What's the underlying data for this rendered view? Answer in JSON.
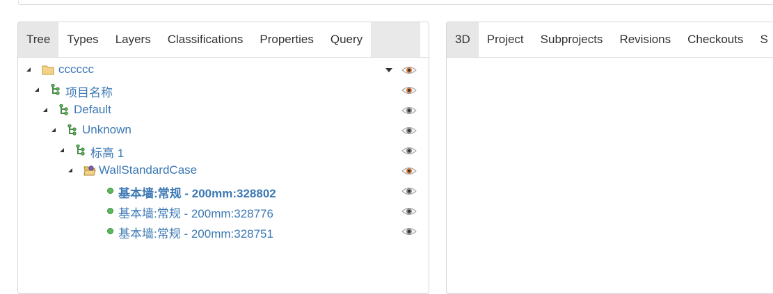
{
  "left_panel": {
    "tabs": [
      "Tree",
      "Types",
      "Layers",
      "Classifications",
      "Properties",
      "Query"
    ],
    "active_tab": "Tree"
  },
  "right_panel": {
    "tabs": [
      "3D",
      "Project",
      "Subprojects",
      "Revisions",
      "Checkouts",
      "S"
    ],
    "active_tab": "3D"
  },
  "tree": {
    "nodes": [
      {
        "label": "cccccc",
        "icon": "folder-icon",
        "level": 0,
        "expanded": true,
        "visible": true,
        "bold": false,
        "dropdown": true
      },
      {
        "label": "项目名称",
        "icon": "hierarchy-icon",
        "level": 1,
        "expanded": true,
        "visible": true,
        "bold": false
      },
      {
        "label": "Default",
        "icon": "hierarchy-icon",
        "level": 2,
        "expanded": true,
        "visible": false,
        "bold": false
      },
      {
        "label": "Unknown",
        "icon": "hierarchy-icon",
        "level": 3,
        "expanded": true,
        "visible": false,
        "bold": false
      },
      {
        "label": "标高 1",
        "icon": "hierarchy-icon",
        "level": 4,
        "expanded": true,
        "visible": false,
        "bold": false
      },
      {
        "label": "WallStandardCase",
        "icon": "open-folder-icon",
        "level": 5,
        "expanded": true,
        "visible": true,
        "bold": false
      },
      {
        "label": "基本墙:常规 - 200mm:328802",
        "icon": "dot-icon",
        "level": 6,
        "visible": false,
        "bold": true
      },
      {
        "label": "基本墙:常规 - 200mm:328776",
        "icon": "dot-icon",
        "level": 6,
        "visible": false,
        "bold": false
      },
      {
        "label": "基本墙:常规 - 200mm:328751",
        "icon": "dot-icon",
        "level": 6,
        "visible": false,
        "bold": false
      }
    ]
  },
  "colors": {
    "link": "#3c78b4",
    "active_tab_bg": "#e7e7e7",
    "eye_visible": "#d9773b",
    "eye_hidden": "#888888",
    "node_green": "#5cb85c"
  }
}
